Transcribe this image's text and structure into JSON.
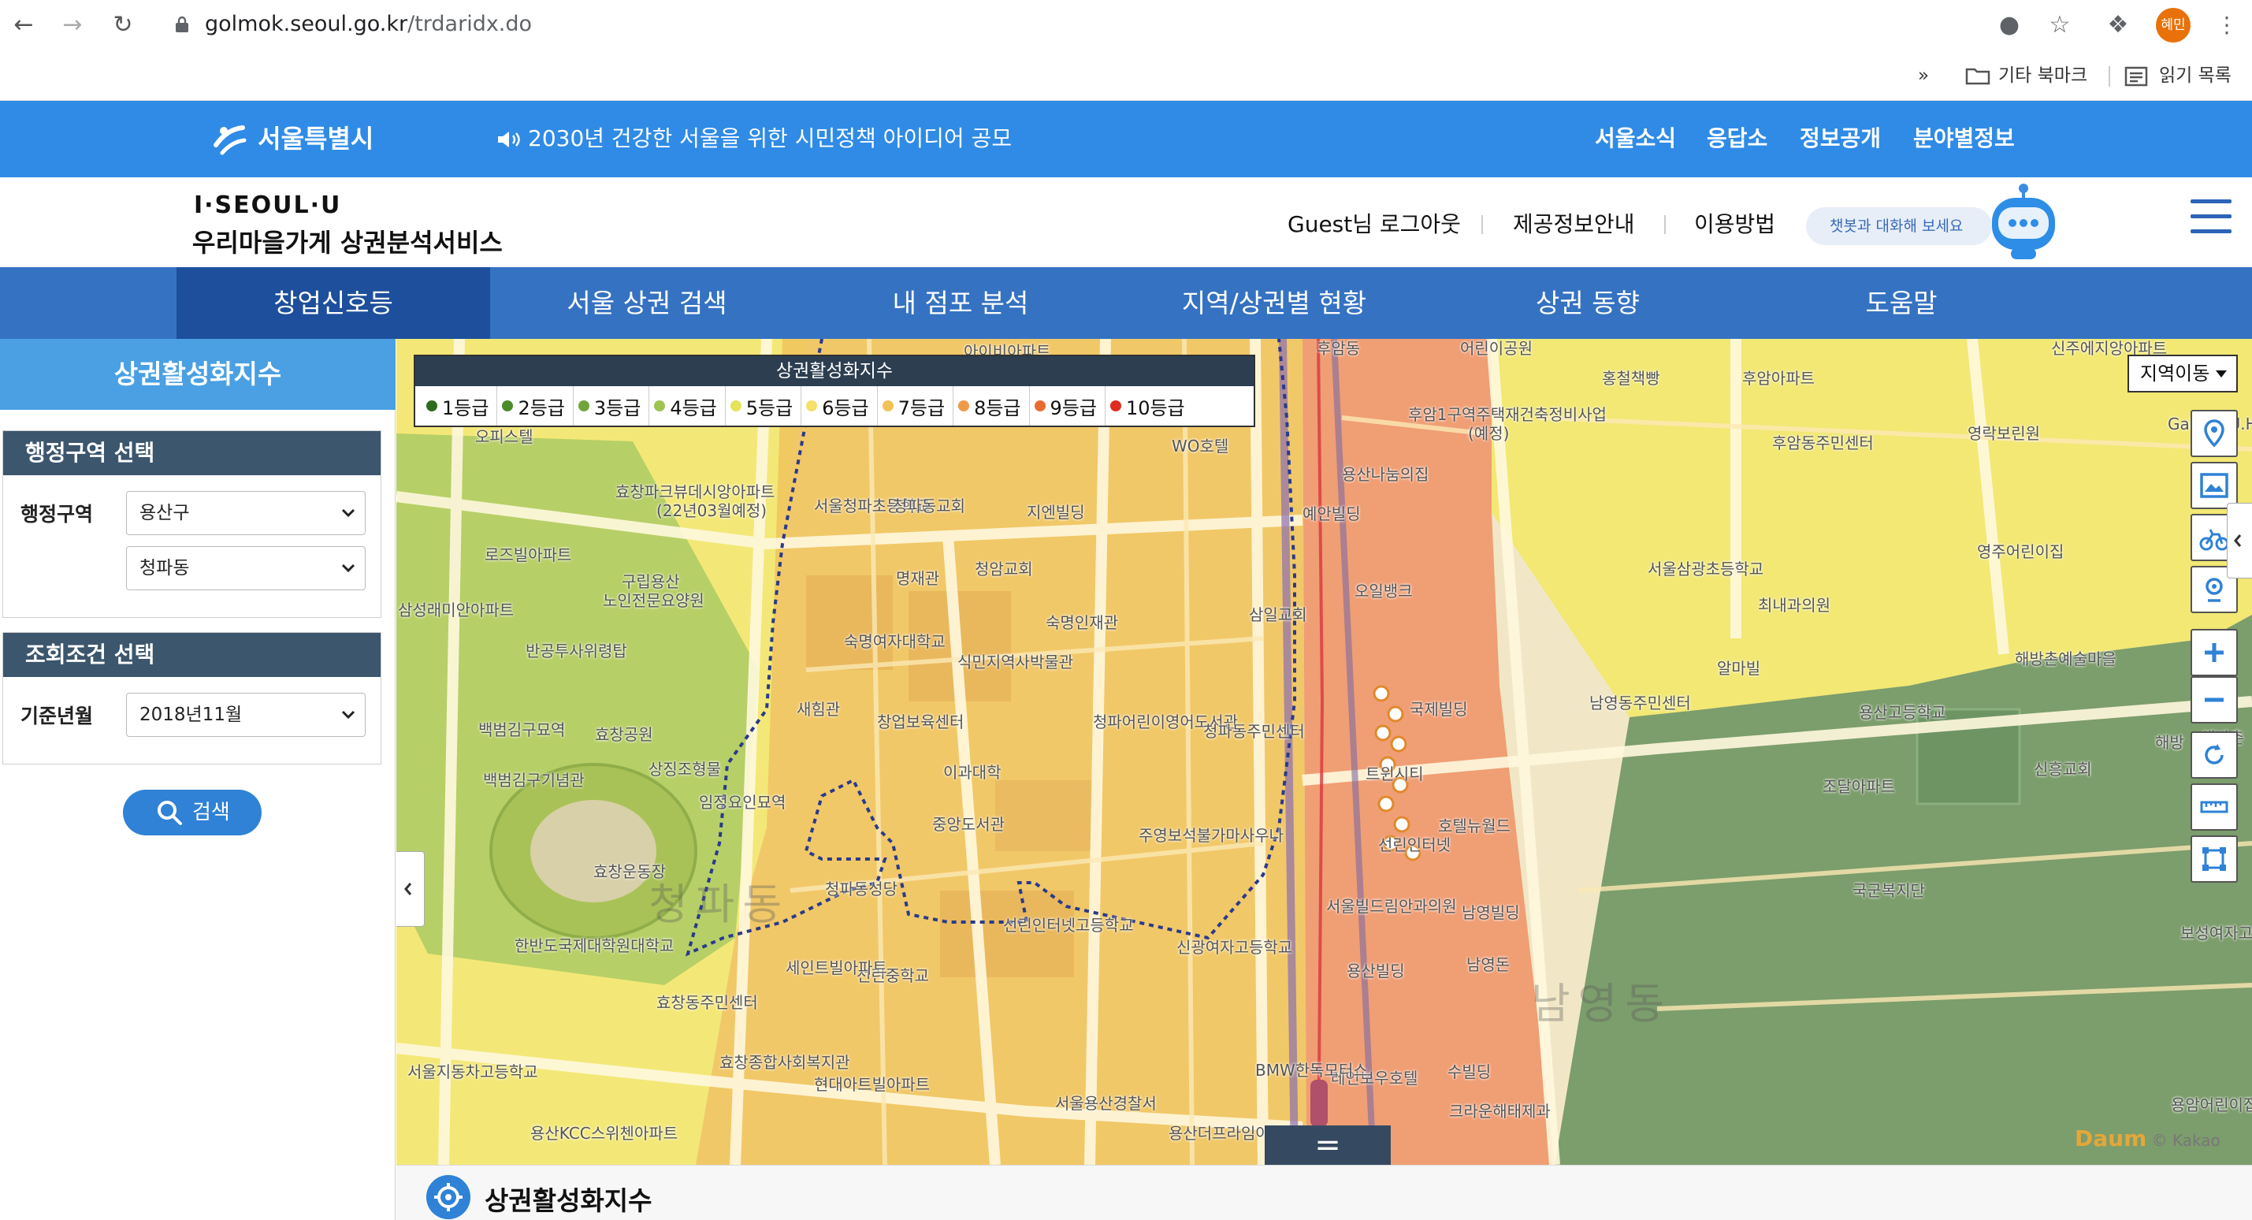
{
  "browser": {
    "url_host": "golmok.seoul.go.kr",
    "url_path": "/trdaridx.do",
    "profile_name": "혜민",
    "bookmarks_more": "»",
    "bookmark_folder": "기타 북마크",
    "reading_list": "읽기 목록"
  },
  "seoul": {
    "logo_text": "서울특별시",
    "notice": "2030년 건강한 서울을 위한 시민정책 아이디어 공모",
    "nav": [
      "서울소식",
      "응답소",
      "정보공개",
      "분야별정보"
    ]
  },
  "service": {
    "brand": "I·SEOUL·U",
    "title": "우리마을가게 상권분석서비스",
    "login": "Guest님 로그아웃",
    "info": "제공정보안내",
    "howto": "이용방법",
    "chatbot": "챗봇과 대화해 보세요"
  },
  "main_nav": [
    "창업신호등",
    "서울 상권 검색",
    "내 점포 분석",
    "지역/상권별 현황",
    "상권 동향",
    "도움말"
  ],
  "sidebar": {
    "title": "상권활성화지수",
    "region_header": "행정구역 선택",
    "region_label": "행정구역",
    "district": "용산구",
    "dong": "청파동",
    "cond_header": "조회조건 선택",
    "month_label": "기준년월",
    "month": "2018년11월",
    "search_button": "검색"
  },
  "map": {
    "legend_title": "상권활성화지수",
    "legend": [
      {
        "label": "1등급",
        "color": "#2e6b1e"
      },
      {
        "label": "2등급",
        "color": "#4c8a2a"
      },
      {
        "label": "3등급",
        "color": "#6fa53a"
      },
      {
        "label": "4등급",
        "color": "#9cc44f"
      },
      {
        "label": "5등급",
        "color": "#e5e35a"
      },
      {
        "label": "6등급",
        "color": "#f4e06a"
      },
      {
        "label": "7등급",
        "color": "#f2c257"
      },
      {
        "label": "8등급",
        "color": "#ee9a48"
      },
      {
        "label": "9등급",
        "color": "#e86a32"
      },
      {
        "label": "10등급",
        "color": "#e02c20"
      }
    ],
    "region_move": "지역이동",
    "bottom_tab": "=",
    "attribution_logo": "Daum",
    "attribution": "© Kakao",
    "dong_labels": [
      "청파동",
      "남영동"
    ],
    "place_labels": [
      "오피스텔",
      "효창파크뷰데시앙아파트",
      "(22년03월예정)",
      "로즈빌아파트",
      "구립용산",
      "노인전문요양원",
      "서울청파초등학교",
      "청파동교회",
      "지엔빌딩",
      "명재관",
      "청암교회",
      "숙명여자대학교",
      "숙명인재관",
      "식민지역사박물관",
      "새힘관",
      "창업보육센터",
      "청파어린이영어도서관",
      "청파동주민센터",
      "이과대학",
      "중앙도서관",
      "주영보석불가마사우나",
      "청파동성당",
      "선린인터넷고등학교",
      "신광여자고등학교",
      "선린중학교",
      "세인트빌아파트",
      "효창종합사회복지관",
      "현대아트빌아파트",
      "서울용산경찰서",
      "용산KCC스위첸아파트",
      "서울지동차고등학교",
      "한반도국제대학원대학교",
      "효창동주민센터",
      "효창운동장",
      "효창공원",
      "상징조형물",
      "백범김구묘역",
      "백범김구기념관",
      "임정요인묘역",
      "반공투사위령탑",
      "삼성래미안아파트",
      "WO호텔",
      "용산나눔의집",
      "예안빌딩",
      "오일뱅크",
      "삼일교회",
      "국제빌딩",
      "호텔뉴월드",
      "서울빌드림안과의원",
      "용산빌딩",
      "남영빌딩",
      "남영돈",
      "레인보우호텔",
      "수빌딩",
      "크라운해태제과",
      "BMW한독모터스",
      "남영동주민센터",
      "홍철책빵",
      "후암아파트",
      "후암동주민센터",
      "영락보린원",
      "서울삼광초등학교",
      "최내과의원",
      "영주어린이집",
      "용산고등학교",
      "해방촌예술마을",
      "조달아파트",
      "신흥교회",
      "국군복지단",
      "보성여자고등학교",
      "해방촌",
      "알마빌",
      "Galler yU.H.M",
      "신주에지앙아파트",
      "어린이공원",
      "후암1구역주택재건축정비사업",
      "(예정)",
      "아이비아파트",
      "후암동",
      "용암어린이집",
      "선린인터넷",
      "트윈시티",
      "용산더프라임아파트",
      "해방"
    ]
  },
  "bottom_panel": {
    "title": "상권활성화지수"
  }
}
